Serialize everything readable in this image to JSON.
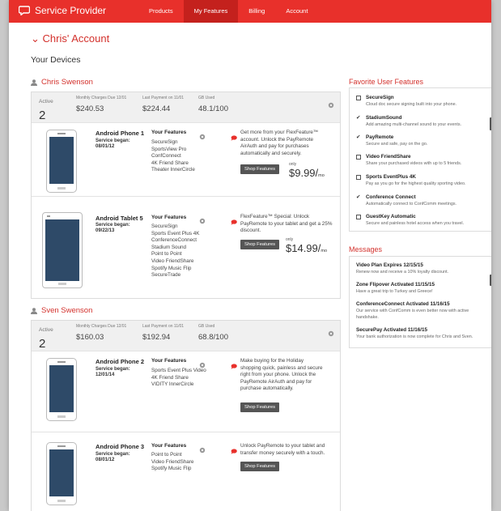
{
  "header": {
    "brand": "Service Provider",
    "nav": [
      "Products",
      "My Features",
      "Billing",
      "Account"
    ],
    "active_nav": "My Features",
    "accent": "#e8302b"
  },
  "account_title": "Chris' Account",
  "devices_title": "Your Devices",
  "users": [
    {
      "name": "Chris Swenson",
      "summary": {
        "active_label": "Active",
        "active_count": "2",
        "charges_label": "Monthly Charges Due 12/01",
        "charges_value": "$240.53",
        "last_payment_label": "Last Payment on 11/01",
        "last_payment_value": "$224.44",
        "gb_label": "GB Used",
        "gb_value": "48.1/100"
      },
      "devices": [
        {
          "name": "Android Phone 1",
          "service_label": "Service began:",
          "service_date": "08/01/12",
          "features_heading": "Your Features",
          "features": [
            "SecureSign",
            "SportsView Pro",
            "ConfConnect",
            "4K Friend Share",
            "Theater InnerCircle"
          ],
          "promo": [
            "Get more from your FlexFeature™",
            "account. Unlock the PayRemote",
            "AirAuth and pay for purchases",
            "automatically and securely."
          ],
          "shop_label": "Shop Features",
          "price_prefix": "only",
          "price": "$9.99/",
          "price_unit": "mo"
        },
        {
          "name": "Android Tablet 5",
          "service_label": "Service began:",
          "service_date": "09/22/13",
          "features_heading": "Your Features",
          "features": [
            "SecureSign",
            "Sports Event Plus 4K",
            "ConferenceConnect",
            "Stadium Sound",
            "Point to Point",
            "Video FriendShare",
            "Spotify Music Flip",
            "SecureTrade"
          ],
          "promo": [
            "FlexFeature™ Special: Unlock",
            "PayRemote to your tablet and get a 25%",
            "discount."
          ],
          "shop_label": "Shop Features",
          "price_prefix": "only",
          "price": "$14.99/",
          "price_unit": "mo"
        }
      ]
    },
    {
      "name": "Sven Swenson",
      "summary": {
        "active_label": "Active",
        "active_count": "2",
        "charges_label": "Monthly Charges Due 12/01",
        "charges_value": "$160.03",
        "last_payment_label": "Last Payment on 11/01",
        "last_payment_value": "$192.94",
        "gb_label": "GB Used",
        "gb_value": "68.8/100"
      },
      "devices": [
        {
          "name": "Android Phone 2",
          "service_label": "Service began:",
          "service_date": "12/01/14",
          "features_heading": "Your Features",
          "features": [
            "Sports Event Plus Video",
            "4K Friend Share",
            "VIDITY InnerCircle"
          ],
          "promo": [
            "Make buying for the Holiday",
            "shopping quick, painless and secure",
            "right from your phone. Unlock the",
            "PayRemote AirAuth and pay for",
            "purchase automatically."
          ],
          "shop_label": "Shop Features"
        },
        {
          "name": "Android Phone 3",
          "service_label": "Service began:",
          "service_date": "08/01/12",
          "features_heading": "Your Features",
          "features": [
            "Point to Point",
            "Video FriendShare",
            "Spotify Music Flip"
          ],
          "promo": [
            "Unlock PayRemote to your tablet and",
            "transfer money securely with a touch."
          ],
          "shop_label": "Shop Features"
        }
      ]
    }
  ],
  "favorites": {
    "title": "Favorite User Features",
    "items": [
      {
        "title": "SecureSign",
        "desc": "Cloud doc secure signing built into your phone.",
        "checked": false
      },
      {
        "title": "StadiumSound",
        "desc": "Add amazing multi-channel sound to your events.",
        "checked": true
      },
      {
        "title": "PayRemote",
        "desc": "Secure and safe, pay on the go.",
        "checked": true
      },
      {
        "title": "Video FriendShare",
        "desc": "Share your purchased videos with up to 5 friends.",
        "checked": false
      },
      {
        "title": "Sports EventPlus 4K",
        "desc": "Pay as you go for the highest quality sporting video.",
        "checked": false
      },
      {
        "title": "Conference Connect",
        "desc": "Automatically connect to ConfComm meetings.",
        "checked": true
      },
      {
        "title": "GuestKey Automatic",
        "desc": "Secure and painless hotel access when you travel.",
        "checked": false
      }
    ]
  },
  "messages": {
    "title": "Messages",
    "items": [
      {
        "title": "Video Plan Expires 12/15/15",
        "desc": "Renew now and receive a 10% loyalty discount."
      },
      {
        "title": "Zone Flipover Activated 11/15/15",
        "desc": "Have a great trip to Turkey and Greece!"
      },
      {
        "title": "ConferenceConnect Activated 11/16/15",
        "desc": "Our service with ConfComm is even better now with active handshake."
      },
      {
        "title": "SecurePay Activated 11/16/15",
        "desc": "Your bank authorization is now complete for Chris and Sven."
      }
    ]
  }
}
